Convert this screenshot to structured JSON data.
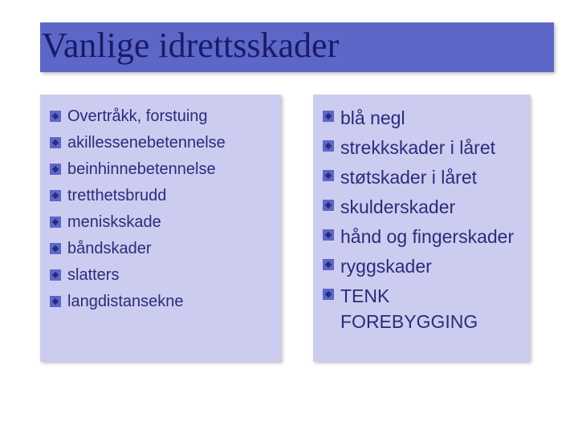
{
  "title": "Vanlige idrettsskader",
  "left_items": [
    "Overtråkk, forstuing",
    "akillessenebetennelse",
    "beinhinnebetennelse",
    "tretthetsbrudd",
    "meniskskade",
    "båndskader",
    "slatters",
    "langdistansekne"
  ],
  "right_items": [
    "blå negl",
    "strekkskader i låret",
    "støtskader i låret",
    "skulderskader",
    "hånd og fingerskader",
    "ryggskader",
    "TENK FOREBYGGING"
  ]
}
